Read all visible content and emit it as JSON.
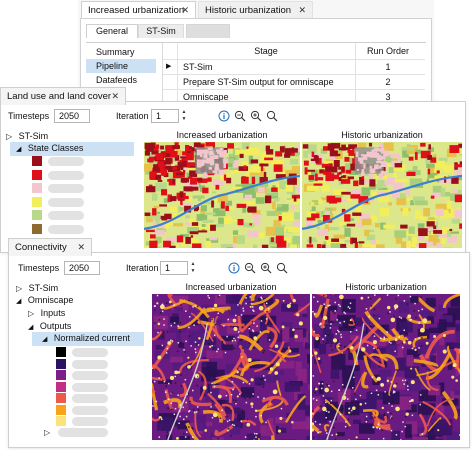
{
  "window1": {
    "tabs": [
      {
        "label": "Increased urbanization",
        "close": "✕"
      },
      {
        "label": "Historic urbanization",
        "close": "✕"
      }
    ],
    "subtabs": [
      {
        "label": "General"
      },
      {
        "label": "ST-Sim"
      }
    ],
    "nav": [
      {
        "label": "Summary"
      },
      {
        "label": "Pipeline"
      },
      {
        "label": "Datafeeds"
      }
    ],
    "grid": {
      "headers": [
        "Stage",
        "Run Order"
      ],
      "rows": [
        {
          "stage": "ST-Sim",
          "order": "1",
          "marker": "▶"
        },
        {
          "stage": "Prepare ST-Sim output for omniscape",
          "order": "2",
          "marker": ""
        },
        {
          "stage": "Omniscape",
          "order": "3",
          "marker": ""
        }
      ]
    }
  },
  "window2": {
    "tab": {
      "label": "Land use and land cover",
      "close": "✕"
    },
    "toolbar": {
      "timesteps_label": "Timesteps",
      "timesteps_value": "2050",
      "iteration_label": "Iteration",
      "iteration_value": "1"
    },
    "tree": {
      "root": "ST-Sim",
      "root_toggle": "▷",
      "child": "State Classes",
      "child_toggle": "◢"
    },
    "legend_colors": [
      "#9b0f1a",
      "#e0101a",
      "#f2c6cc",
      "#f2ee5c",
      "#b9d98a",
      "#8f6a2e"
    ],
    "maps": [
      {
        "title": "Increased urbanization"
      },
      {
        "title": "Historic urbanization"
      }
    ]
  },
  "window3": {
    "tab": {
      "label": "Connectivity",
      "close": "✕"
    },
    "toolbar": {
      "timesteps_label": "Timesteps",
      "timesteps_value": "2050",
      "iteration_label": "Iteration",
      "iteration_value": "1"
    },
    "tree": {
      "root": "ST-Sim",
      "root_toggle": "▷",
      "omni": "Omniscape",
      "omni_toggle": "◢",
      "inputs": "Inputs",
      "inputs_toggle": "▷",
      "outputs": "Outputs",
      "outputs_toggle": "◢",
      "current": "Normalized current",
      "current_toggle": "◢",
      "more_toggle": "▷"
    },
    "legend_colors": [
      "#000000",
      "#2b1162",
      "#7d1f8a",
      "#c12e83",
      "#ee5a4a",
      "#f9a21c",
      "#fbe27a"
    ],
    "maps": [
      {
        "title": "Increased urbanization"
      },
      {
        "title": "Historic urbanization"
      }
    ]
  },
  "icons": {
    "info": "info-icon",
    "zoom_out": "zoom-out-icon",
    "zoom_in": "zoom-in-icon",
    "search": "search-icon"
  }
}
